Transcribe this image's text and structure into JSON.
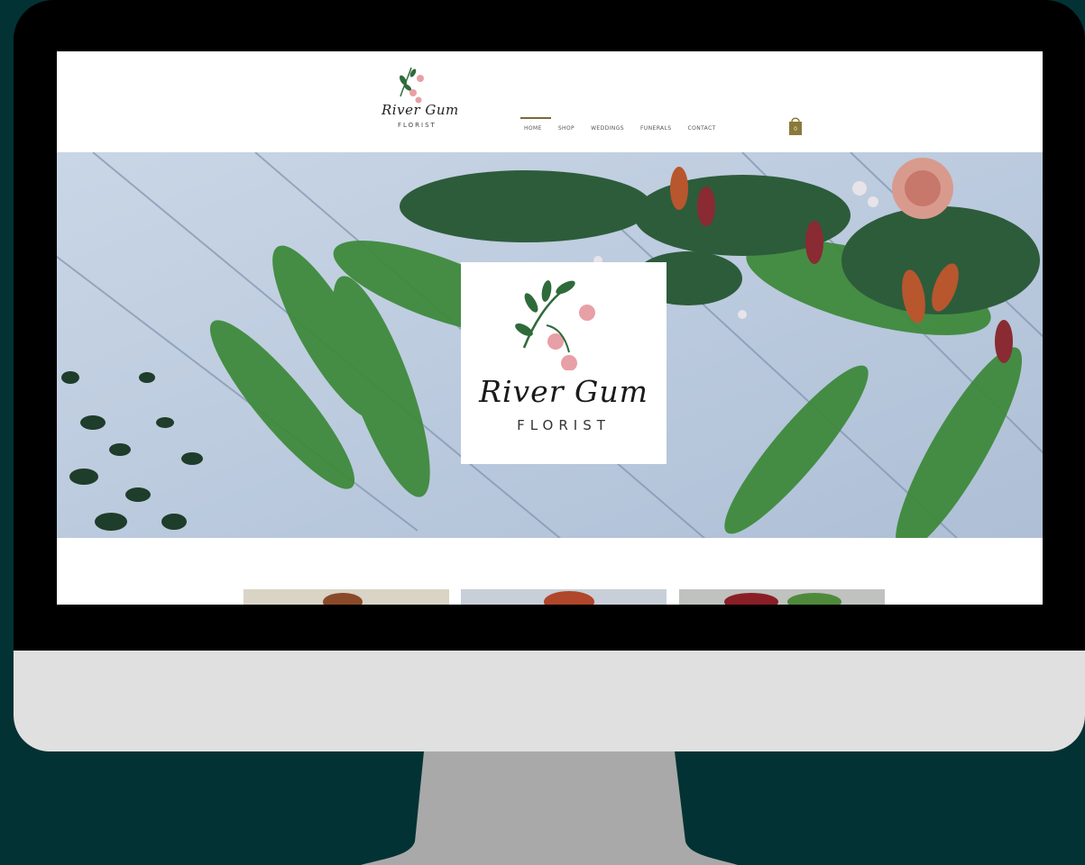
{
  "site": {
    "brand_script": "River Gum",
    "brand_sub": "FLORIST"
  },
  "nav": {
    "items": [
      {
        "label": "HOME",
        "active": true
      },
      {
        "label": "SHOP",
        "active": false
      },
      {
        "label": "WEDDINGS",
        "active": false
      },
      {
        "label": "FUNERALS",
        "active": false
      },
      {
        "label": "CONTACT",
        "active": false
      }
    ],
    "cart_count": "0"
  },
  "hero": {
    "card_script": "River Gum",
    "card_sub": "FLORIST"
  },
  "colors": {
    "background": "#033234",
    "accent": "#7a6a3a",
    "leaf": "#2f6b3a",
    "flower": "#e7a0a5"
  }
}
